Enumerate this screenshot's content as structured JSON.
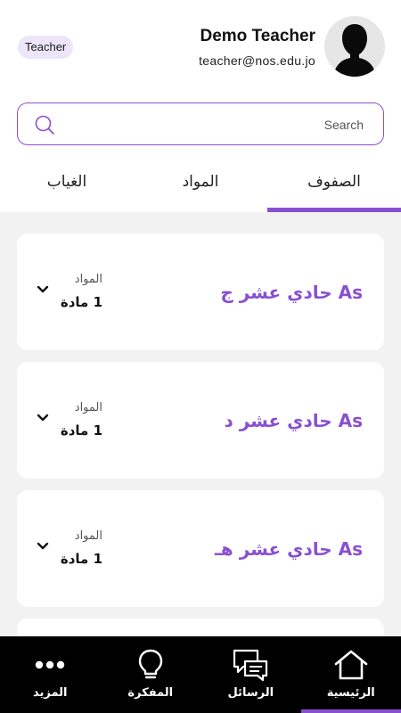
{
  "header": {
    "role": "Teacher",
    "name": "Demo Teacher",
    "email": "teacher@nos.edu.jo"
  },
  "search": {
    "placeholder": "Search",
    "value": ""
  },
  "tabs": [
    {
      "label": "الصفوف",
      "active": true
    },
    {
      "label": "المواد",
      "active": false
    },
    {
      "label": "الغياب",
      "active": false
    }
  ],
  "classes": [
    {
      "title": "As حادي عشر ج",
      "subjects_label": "المواد",
      "subjects_count": "1 مادة"
    },
    {
      "title": "As حادي عشر د",
      "subjects_label": "المواد",
      "subjects_count": "1 مادة"
    },
    {
      "title": "As حادي عشر هـ",
      "subjects_label": "المواد",
      "subjects_count": "1 مادة"
    }
  ],
  "bottom_nav": [
    {
      "label": "الرئيسية",
      "icon": "home-icon",
      "active": true
    },
    {
      "label": "الرسائل",
      "icon": "chat-icon",
      "active": false
    },
    {
      "label": "المفكرة",
      "icon": "lightbulb-icon",
      "active": false
    },
    {
      "label": "المزيد",
      "icon": "more-icon",
      "active": false
    }
  ],
  "colors": {
    "accent": "#8a4fd0",
    "badge_bg": "#ede6fa",
    "content_bg": "#f2f2f2",
    "nav_bg": "#000000"
  }
}
